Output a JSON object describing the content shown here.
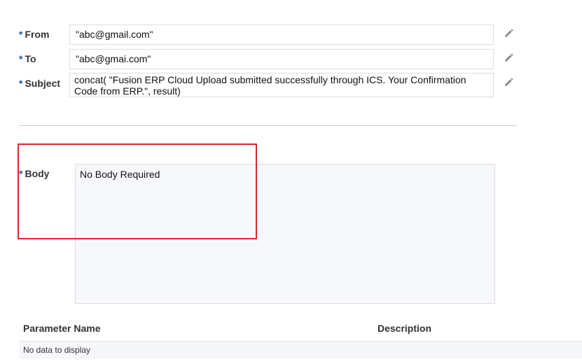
{
  "form": {
    "required_mark": "*",
    "from": {
      "label": "From",
      "value": "\"abc@gmail.com\""
    },
    "to": {
      "label": "To",
      "value": "\"abc@gmai.com\""
    },
    "subject": {
      "label": "Subject",
      "value": "concat( \"Fusion ERP Cloud Upload submitted successfully through ICS. Your Confirmation Code from ERP.\", result)"
    },
    "body": {
      "label": "Body",
      "value": "No Body Required"
    }
  },
  "parameters_table": {
    "columns": [
      "Parameter Name",
      "Description"
    ],
    "empty_message": "No data to display"
  },
  "colors": {
    "required_mark": "#1a5a9b",
    "highlight_border": "#d62b2b",
    "field_border": "#dddddd",
    "body_background": "#f7f8fb"
  },
  "icons": {
    "edit": "pencil-icon"
  }
}
